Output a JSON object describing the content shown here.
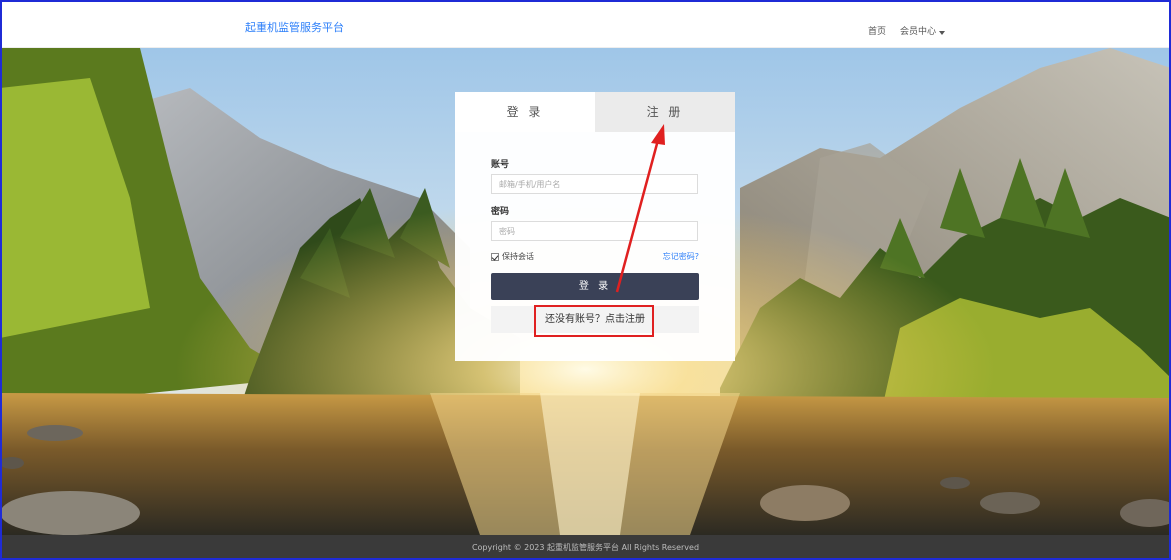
{
  "header": {
    "brand": "起重机监管服务平台",
    "nav": [
      {
        "label": "首页"
      },
      {
        "label": "会员中心"
      }
    ]
  },
  "login": {
    "tabs": [
      {
        "label": "登 录",
        "active": true
      },
      {
        "label": "注 册",
        "active": false
      }
    ],
    "account_label": "账号",
    "account_placeholder": "邮箱/手机/用户名",
    "password_label": "密码",
    "password_placeholder": "密码",
    "remember_label": "保持会话",
    "remember_checked": true,
    "forgot_label": "忘记密码?",
    "submit_label": "登 录",
    "register_label": "还没有账号？点击注册"
  },
  "footer": {
    "text": "Copyright © 2023 起重机监管服务平台 All Rights Reserved"
  },
  "colors": {
    "brand": "#2d7ff9",
    "button": "#3a4157",
    "annotation": "#e02020",
    "footer": "#3a3a3a",
    "frame": "#1f2bd6"
  },
  "icons": {
    "checkbox": "checkbox-checked-icon",
    "caret": "caret-down-icon",
    "arrow": "red-arrow-annotation"
  }
}
